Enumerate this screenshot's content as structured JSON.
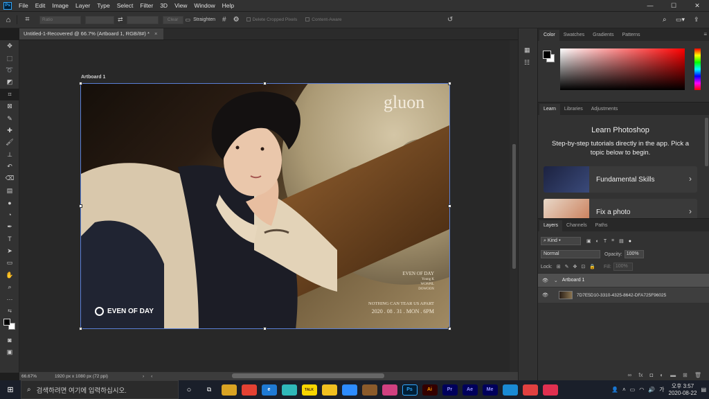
{
  "menu": {
    "logo": "Ps",
    "items": [
      "File",
      "Edit",
      "Image",
      "Layer",
      "Type",
      "Select",
      "Filter",
      "3D",
      "View",
      "Window",
      "Help"
    ],
    "window_controls": [
      "—",
      "☐",
      "✕"
    ]
  },
  "options": {
    "ratio_placeholder": "Ratio",
    "clear": "Clear",
    "straighten": "Straighten",
    "delete_cropped": "Delete Cropped Pixels",
    "content_aware": "Content-Aware"
  },
  "document": {
    "tab_title": "Untitled-1-Recovered @ 66.7% (Artboard 1, RGB/8#) *",
    "tab_close": "×",
    "artboard_title": "Artboard 1",
    "zoom": "66.67%",
    "size_info": "1920 px x 1080 px (72 ppi)"
  },
  "artwork": {
    "logo": "gluon",
    "event_title": "EVEN OF DAY",
    "members": [
      "Young K",
      "WONPIL",
      "DOWOON"
    ],
    "tagline": "NOTHING CAN TEAR US APART",
    "date": "2020 . 08 . 31 . MON . 6PM",
    "brand": "EVEN OF DAY"
  },
  "color_panel": {
    "tabs": [
      "Color",
      "Swatches",
      "Gradients",
      "Patterns"
    ],
    "foreground": "#000000",
    "background": "#ffffff"
  },
  "learn_panel": {
    "tabs": [
      "Learn",
      "Libraries",
      "Adjustments"
    ],
    "heading": "Learn Photoshop",
    "description": "Step-by-step tutorials directly in the app. Pick a topic below to begin.",
    "cards": [
      {
        "label": "Fundamental Skills",
        "arrow": "›"
      },
      {
        "label": "Fix a photo",
        "arrow": "›"
      }
    ]
  },
  "layers_panel": {
    "tabs": [
      "Layers",
      "Channels",
      "Paths"
    ],
    "filter": "Kind",
    "blend_mode": "Normal",
    "opacity_label": "Opacity:",
    "opacity": "100%",
    "lock_label": "Lock:",
    "fill_label": "Fill:",
    "fill": "100%",
    "layers": [
      {
        "name": "Artboard 1"
      },
      {
        "name": "7D7E5D10-3310-4325-8642-DFA725F96025"
      }
    ]
  },
  "taskbar": {
    "search_placeholder": "검색하려면 여기에 입력하십시오.",
    "apps": [
      {
        "label": "",
        "color": "#d9a323"
      },
      {
        "label": "",
        "color": "#e34133"
      },
      {
        "label": "e",
        "color": "#1f7ad4"
      },
      {
        "label": "",
        "color": "#2fb8ba"
      },
      {
        "label": "TALK",
        "color": "#f7d600"
      },
      {
        "label": "",
        "color": "#f0c020"
      },
      {
        "label": "",
        "color": "#2d8cff"
      },
      {
        "label": "",
        "color": "#8a5a2b"
      },
      {
        "label": "",
        "color": "#d04080"
      },
      {
        "label": "Ps",
        "color": "#001e36"
      },
      {
        "label": "Ai",
        "color": "#330000"
      },
      {
        "label": "Pr",
        "color": "#00005b"
      },
      {
        "label": "Ae",
        "color": "#00005b"
      },
      {
        "label": "Me",
        "color": "#00005b"
      },
      {
        "label": "",
        "color": "#1a8ad4"
      },
      {
        "label": "",
        "color": "#e04040"
      },
      {
        "label": "",
        "color": "#e03050"
      }
    ],
    "time": "오후 3:57",
    "date": "2020-08-22"
  }
}
